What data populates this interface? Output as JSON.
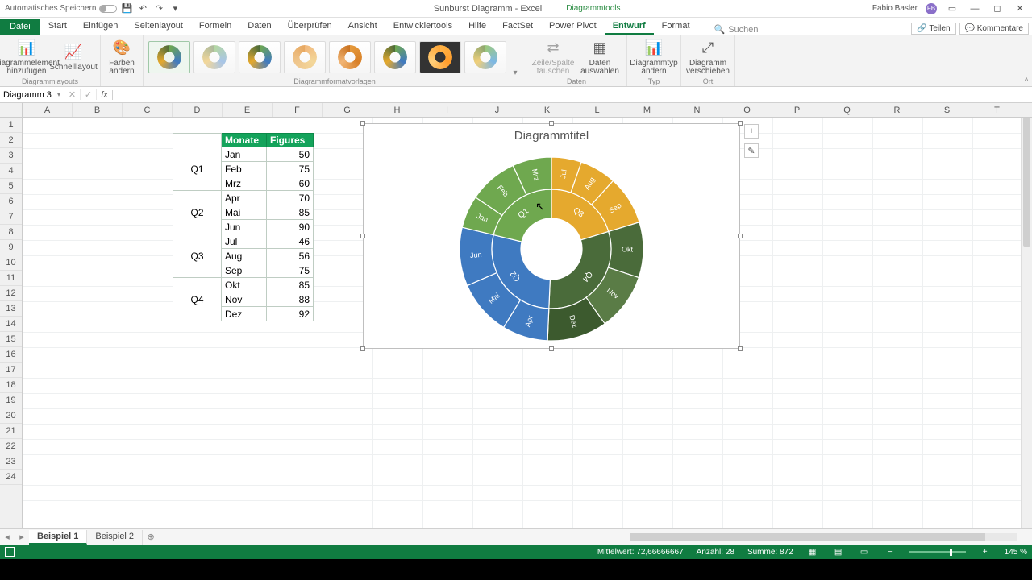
{
  "titlebar": {
    "autosave_label": "Automatisches Speichern",
    "doc_title": "Sunburst Diagramm - Excel",
    "tools_title": "Diagrammtools",
    "user_name": "Fabio Basler",
    "user_initials": "FB"
  },
  "ribbon_tabs": {
    "file": "Datei",
    "tabs": [
      "Start",
      "Einfügen",
      "Seitenlayout",
      "Formeln",
      "Daten",
      "Überprüfen",
      "Ansicht",
      "Entwicklertools",
      "Hilfe",
      "FactSet",
      "Power Pivot",
      "Entwurf",
      "Format"
    ],
    "active_index": 11,
    "search_placeholder": "Suchen",
    "share": "Teilen",
    "comments": "Kommentare"
  },
  "ribbon": {
    "add_element": "Diagrammelement hinzufügen",
    "quick_layout": "Schnelllayout",
    "change_colors": "Farben ändern",
    "group_layouts": "Diagrammlayouts",
    "group_styles": "Diagrammformatvorlagen",
    "switch_rowcol": "Zeile/Spalte tauschen",
    "select_data": "Daten auswählen",
    "group_data": "Daten",
    "change_type": "Diagrammtyp ändern",
    "group_type": "Typ",
    "move_chart": "Diagramm verschieben",
    "group_location": "Ort"
  },
  "namebox": "Diagramm 3",
  "columns": [
    "A",
    "B",
    "C",
    "D",
    "E",
    "F",
    "G",
    "H",
    "I",
    "J",
    "K",
    "L",
    "M",
    "N",
    "O",
    "P",
    "Q",
    "R",
    "S",
    "T"
  ],
  "row_count": 24,
  "table": {
    "header_month": "Monate",
    "header_fig": "Figures",
    "groups": [
      {
        "q": "Q1",
        "rows": [
          [
            "Jan",
            "50"
          ],
          [
            "Feb",
            "75"
          ],
          [
            "Mrz",
            "60"
          ]
        ]
      },
      {
        "q": "Q2",
        "rows": [
          [
            "Apr",
            "70"
          ],
          [
            "Mai",
            "85"
          ],
          [
            "Jun",
            "90"
          ]
        ]
      },
      {
        "q": "Q3",
        "rows": [
          [
            "Jul",
            "46"
          ],
          [
            "Aug",
            "56"
          ],
          [
            "Sep",
            "75"
          ]
        ]
      },
      {
        "q": "Q4",
        "rows": [
          [
            "Okt",
            "85"
          ],
          [
            "Nov",
            "88"
          ],
          [
            "Dez",
            "92"
          ]
        ]
      }
    ]
  },
  "chart": {
    "title": "Diagrammtitel"
  },
  "chart_data": {
    "type": "sunburst",
    "title": "Diagrammtitel",
    "hierarchy": [
      {
        "name": "Q1",
        "color": "#6fa84f",
        "children": [
          {
            "name": "Jan",
            "value": 50
          },
          {
            "name": "Feb",
            "value": 75
          },
          {
            "name": "Mrz",
            "value": 60
          }
        ]
      },
      {
        "name": "Q2",
        "color": "#3f7ac1",
        "children": [
          {
            "name": "Apr",
            "value": 70
          },
          {
            "name": "Mai",
            "value": 85
          },
          {
            "name": "Jun",
            "value": 90
          }
        ]
      },
      {
        "name": "Q3",
        "color": "#e5a92e",
        "children": [
          {
            "name": "Jul",
            "value": 46
          },
          {
            "name": "Aug",
            "value": 56
          },
          {
            "name": "Sep",
            "value": 75
          }
        ]
      },
      {
        "name": "Q4",
        "color": "#4a6b3a",
        "children": [
          {
            "name": "Okt",
            "value": 85
          },
          {
            "name": "Nov",
            "value": 88
          },
          {
            "name": "Dez",
            "value": 92
          }
        ]
      }
    ],
    "total": 872
  },
  "sheets": {
    "active": "Beispiel 1",
    "tabs": [
      "Beispiel 1",
      "Beispiel 2"
    ]
  },
  "status": {
    "avg_label": "Mittelwert:",
    "avg": "72,66666667",
    "count_label": "Anzahl:",
    "count": "28",
    "sum_label": "Summe:",
    "sum": "872",
    "zoom": "145 %"
  }
}
